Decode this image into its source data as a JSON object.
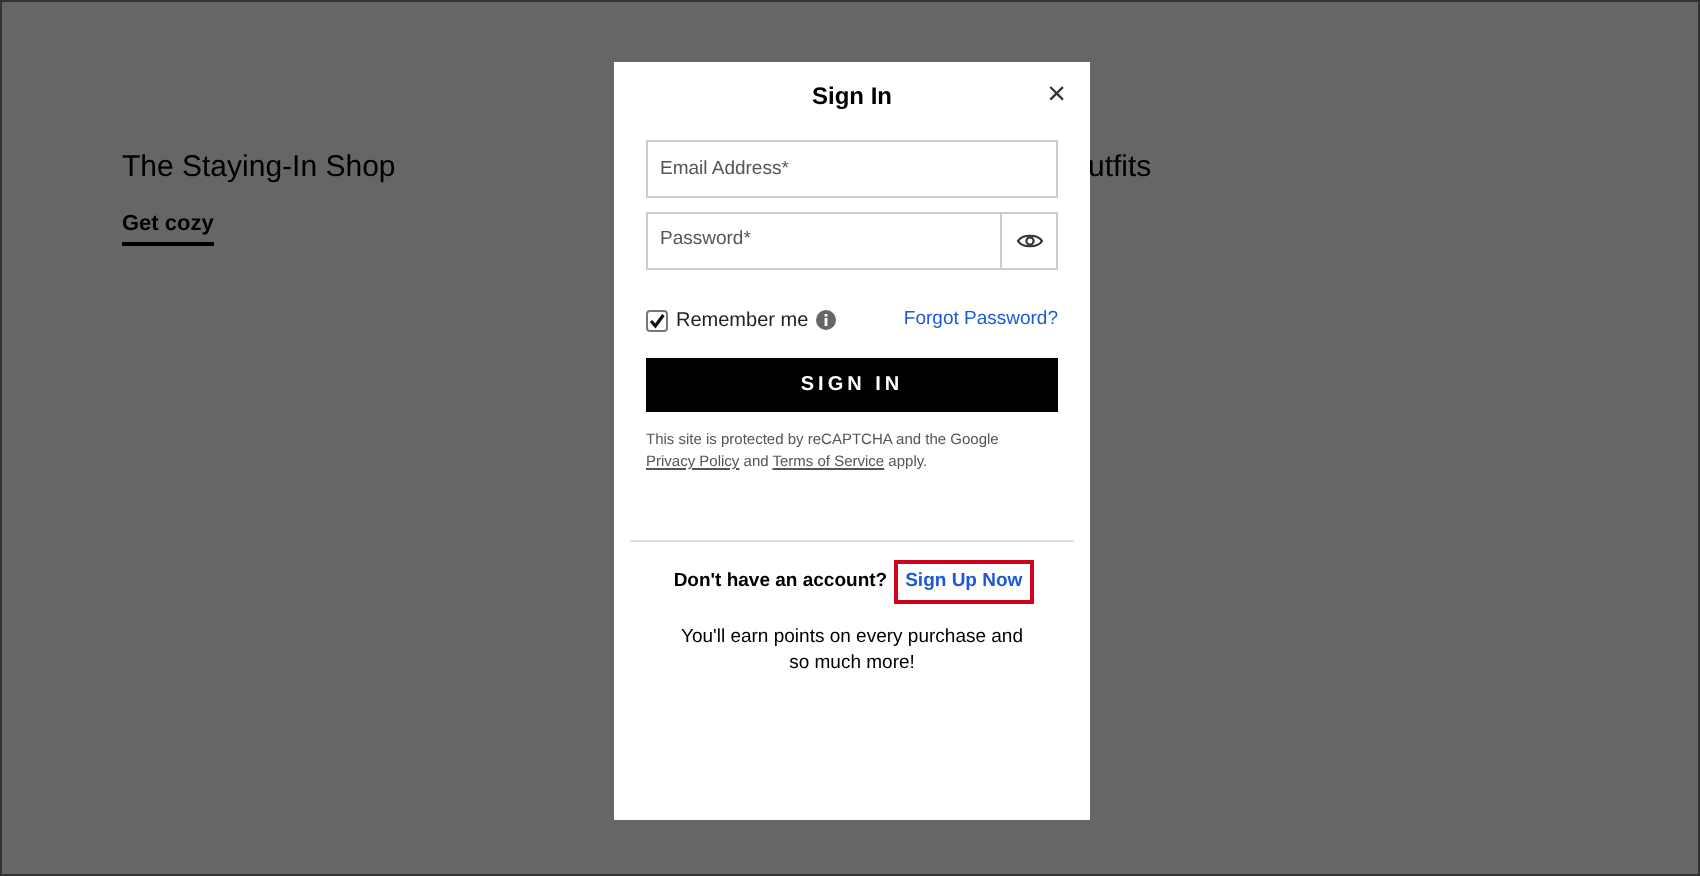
{
  "background": {
    "promos": [
      {
        "title": "The Staying-In Shop",
        "link": "Get cozy"
      }
    ],
    "cut_title": "utfits"
  },
  "dialog": {
    "title": "Sign In",
    "close": "×",
    "fields": [
      {
        "kind": "text",
        "placeholder": "Email Address*"
      },
      {
        "kind": "password",
        "placeholder": "Password*"
      }
    ],
    "remember": {
      "label": "Remember me",
      "checked": true
    },
    "forgot": "Forgot Password?",
    "submit": "SIGN IN",
    "legal": {
      "before": "This site is protected by reCAPTCHA and the Google",
      "links": [
        "Privacy Policy",
        "Terms of Service"
      ],
      "joiner": "and",
      "after": "apply."
    },
    "signup": {
      "prompt": "Don't have an account?",
      "link": "Sign Up Now",
      "highlighted": true
    },
    "note": "You'll earn points on every purchase and so much more!"
  }
}
